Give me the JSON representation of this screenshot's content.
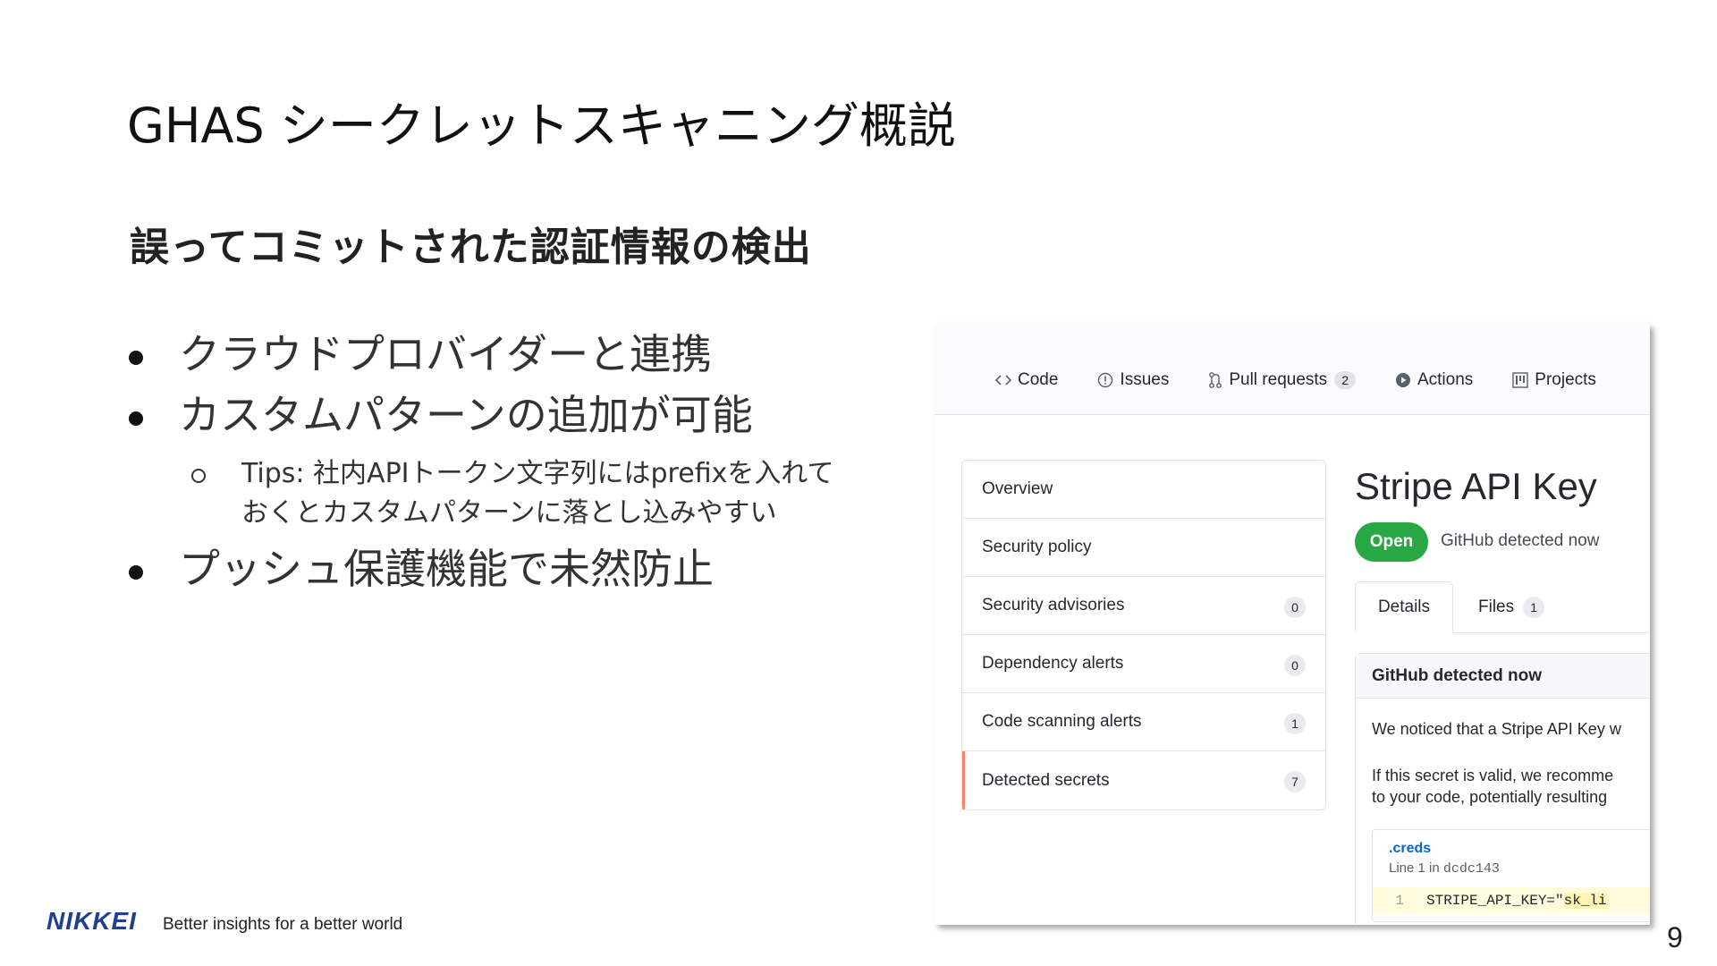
{
  "slide": {
    "title": "GHAS シークレットスキャニング概説",
    "subtitle": "誤ってコミットされた認証情報の検出",
    "bullets": [
      "クラウドプロバイダーと連携",
      "カスタムパターンの追加が可能",
      "プッシュ保護機能で未然防止"
    ],
    "sub_bullet_lines": [
      "Tips: 社内APIトークン文字列にはprefixを入れて",
      "おくとカスタムパターンに落とし込みやすい"
    ],
    "page_number": "9"
  },
  "footer": {
    "logo": "NIKKEI",
    "tagline": "Better insights for a better world"
  },
  "screenshot": {
    "repo_nav": {
      "code": "Code",
      "issues": "Issues",
      "pull_requests": "Pull requests",
      "pull_requests_count": "2",
      "actions": "Actions",
      "projects": "Projects"
    },
    "menu": [
      {
        "label": "Overview",
        "count": ""
      },
      {
        "label": "Security policy",
        "count": ""
      },
      {
        "label": "Security advisories",
        "count": "0"
      },
      {
        "label": "Dependency alerts",
        "count": "0"
      },
      {
        "label": "Code scanning alerts",
        "count": "1"
      },
      {
        "label": "Detected secrets",
        "count": "7"
      }
    ],
    "alert_title": "Stripe API Key",
    "status": "Open",
    "detected": "GitHub detected now",
    "tabs": {
      "details": "Details",
      "files": "Files",
      "files_count": "1"
    },
    "box": {
      "header": "GitHub detected now",
      "p1": "We noticed that a Stripe API Key w",
      "p2_line1": "If this secret is valid, we recomme",
      "p2_line2": "to your code, potentially resulting",
      "file_name": ".creds",
      "file_meta_prefix": "Line 1 in",
      "file_sha": "dcdc143",
      "line_number": "1",
      "code_key": "STRIPE_API_KEY=\"",
      "code_secret": "sk_li"
    },
    "colors": {
      "open_badge": "#28a745",
      "selected_accent": "#f9826c",
      "link": "#0366d6"
    }
  }
}
